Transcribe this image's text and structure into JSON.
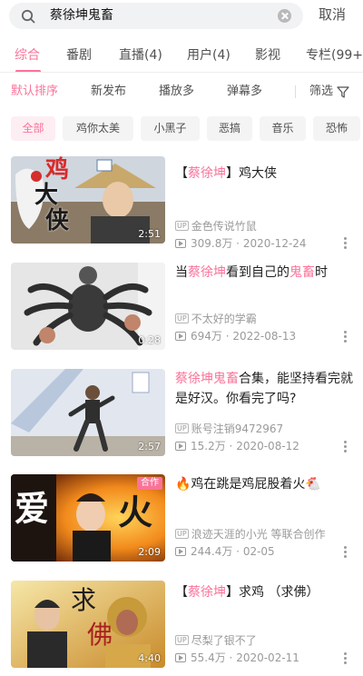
{
  "search": {
    "query": "蔡徐坤鬼畜",
    "cancel_label": "取消",
    "icon": "search-icon",
    "clear_icon": "clear-icon"
  },
  "tabs": [
    {
      "label": "综合",
      "active": true
    },
    {
      "label": "番剧",
      "active": false
    },
    {
      "label": "直播(4)",
      "active": false
    },
    {
      "label": "用户(4)",
      "active": false
    },
    {
      "label": "影视",
      "active": false
    },
    {
      "label": "专栏(99+)",
      "active": false
    }
  ],
  "sort": {
    "options": [
      {
        "label": "默认排序",
        "active": true
      },
      {
        "label": "新发布",
        "active": false
      },
      {
        "label": "播放多",
        "active": false
      },
      {
        "label": "弹幕多",
        "active": false
      }
    ],
    "filter_label": "筛选",
    "filter_icon": "filter-icon"
  },
  "chips": [
    {
      "label": "全部",
      "active": true
    },
    {
      "label": "鸡你太美",
      "active": false
    },
    {
      "label": "小黑子",
      "active": false
    },
    {
      "label": "恶搞",
      "active": false
    },
    {
      "label": "音乐",
      "active": false
    },
    {
      "label": "恐怖",
      "active": false
    }
  ],
  "videos": [
    {
      "title_parts": [
        {
          "text": "【",
          "hl": false
        },
        {
          "text": "蔡徐坤",
          "hl": true
        },
        {
          "text": "】鸡大侠",
          "hl": false
        }
      ],
      "uploader": "金色传说竹鼠",
      "views": "309.8万",
      "date": "2020-12-24",
      "duration": "2:51",
      "thumb_text": [
        "鸡",
        "大",
        "侠"
      ],
      "badge": ""
    },
    {
      "title_parts": [
        {
          "text": "当",
          "hl": false
        },
        {
          "text": "蔡徐坤",
          "hl": true
        },
        {
          "text": "看到自己的",
          "hl": false
        },
        {
          "text": "鬼畜",
          "hl": true
        },
        {
          "text": "时",
          "hl": false
        }
      ],
      "uploader": "不太好的学霸",
      "views": "694万",
      "date": "2022-08-13",
      "duration": "0:28",
      "thumb_text": [],
      "badge": ""
    },
    {
      "title_parts": [
        {
          "text": "蔡徐坤鬼畜",
          "hl": true
        },
        {
          "text": "合集，能坚持看完就是好汉。你看完了吗?",
          "hl": false
        }
      ],
      "uploader": "账号注销9472967",
      "views": "15.2万",
      "date": "2020-08-12",
      "duration": "2:57",
      "thumb_text": [],
      "badge": ""
    },
    {
      "title_parts": [
        {
          "text": "🔥鸡在跳是鸡屁股着火🐔",
          "hl": false
        }
      ],
      "uploader": "浪迹天涯的小光 等联合创作",
      "views": "244.4万",
      "date": "02-05",
      "duration": "2:09",
      "thumb_text": [
        "爱",
        "火"
      ],
      "badge": "合作"
    },
    {
      "title_parts": [
        {
          "text": "【",
          "hl": false
        },
        {
          "text": "蔡徐坤",
          "hl": true
        },
        {
          "text": "】求鸡 （求佛）",
          "hl": false
        }
      ],
      "uploader": "尽梨了银不了",
      "views": "55.4万",
      "date": "2020-02-11",
      "duration": "4:40",
      "thumb_text": [
        "求",
        "佛"
      ],
      "badge": ""
    }
  ],
  "labels": {
    "up_badge": "UP"
  },
  "colors": {
    "accent": "#fb7299",
    "meta": "#9a9a9a"
  }
}
